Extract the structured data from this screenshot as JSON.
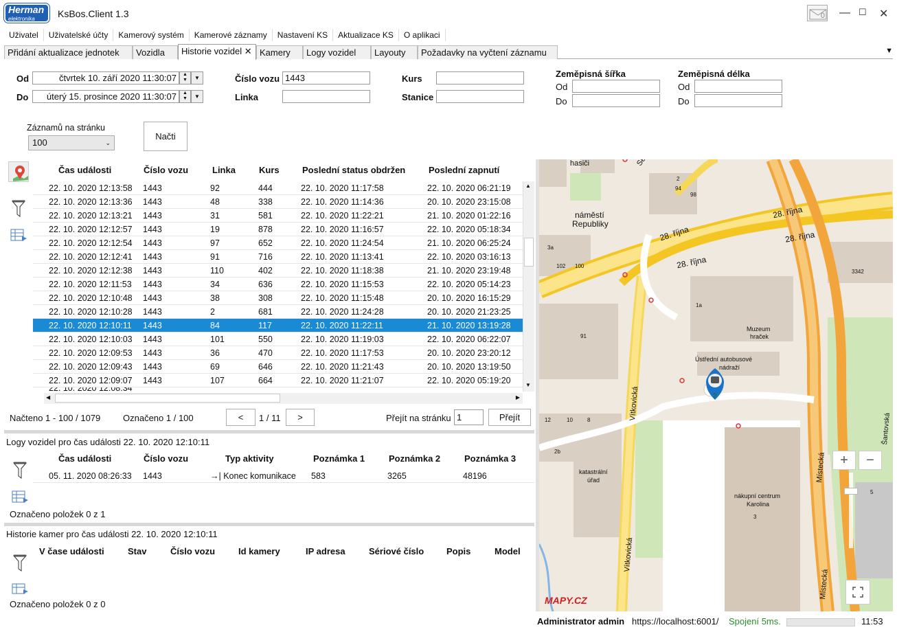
{
  "app": {
    "logo_line1": "Herman",
    "logo_line2": "elektronika",
    "title": "KsBos.Client 1.3",
    "mail_count": "0"
  },
  "menu": [
    "Uživatel",
    "Uživatelské účty",
    "Kamerový systém",
    "Kamerové záznamy",
    "Nastavení KS",
    "Aktualizace KS",
    "O aplikaci"
  ],
  "tabs": [
    {
      "label": "Přidání aktualizace jednotek"
    },
    {
      "label": "Vozidla"
    },
    {
      "label": "Historie vozidel"
    },
    {
      "label": "Kamery"
    },
    {
      "label": "Logy vozidel"
    },
    {
      "label": "Layouty"
    },
    {
      "label": "Požadavky na vyčtení záznamu"
    }
  ],
  "filters": {
    "od_label": "Od",
    "do_label": "Do",
    "od_value": "čtvrtek 10. září 2020 11:30:07",
    "do_value": "úterý 15. prosince 2020 11:30:07",
    "cislo_vozu_label": "Číslo vozu",
    "cislo_vozu_value": "1443",
    "linka_label": "Linka",
    "linka_value": "",
    "kurs_label": "Kurs",
    "kurs_value": "",
    "stanice_label": "Stanice",
    "stanice_value": "",
    "lat_label": "Zeměpisná šířka",
    "lon_label": "Zeměpisná délka",
    "lat_od_label": "Od",
    "lat_do_label": "Do",
    "lon_od_label": "Od",
    "lon_do_label": "Do",
    "per_page_label": "Záznamů na stránku",
    "per_page_value": "100",
    "load_button": "Načti"
  },
  "grid": {
    "headers": [
      "Čas události",
      "Číslo vozu",
      "Linka",
      "Kurs",
      "Poslední status obdržen",
      "Poslední zapnutí"
    ],
    "rows": [
      [
        "22. 10. 2020 12:13:58",
        "1443",
        "92",
        "444",
        "22. 10. 2020 11:17:58",
        "22. 10. 2020 06:21:19"
      ],
      [
        "22. 10. 2020 12:13:36",
        "1443",
        "48",
        "338",
        "22. 10. 2020 11:14:36",
        "20. 10. 2020 23:15:08"
      ],
      [
        "22. 10. 2020 12:13:21",
        "1443",
        "31",
        "581",
        "22. 10. 2020 11:22:21",
        "21. 10. 2020 01:22:16"
      ],
      [
        "22. 10. 2020 12:12:57",
        "1443",
        "19",
        "878",
        "22. 10. 2020 11:16:57",
        "22. 10. 2020 05:18:34"
      ],
      [
        "22. 10. 2020 12:12:54",
        "1443",
        "97",
        "652",
        "22. 10. 2020 11:24:54",
        "21. 10. 2020 06:25:24"
      ],
      [
        "22. 10. 2020 12:12:41",
        "1443",
        "91",
        "716",
        "22. 10. 2020 11:13:41",
        "22. 10. 2020 03:16:13"
      ],
      [
        "22. 10. 2020 12:12:38",
        "1443",
        "110",
        "402",
        "22. 10. 2020 11:18:38",
        "21. 10. 2020 23:19:48"
      ],
      [
        "22. 10. 2020 12:11:53",
        "1443",
        "34",
        "636",
        "22. 10. 2020 11:15:53",
        "22. 10. 2020 05:14:23"
      ],
      [
        "22. 10. 2020 12:10:48",
        "1443",
        "38",
        "308",
        "22. 10. 2020 11:15:48",
        "20. 10. 2020 16:15:29"
      ],
      [
        "22. 10. 2020 12:10:28",
        "1443",
        "2",
        "681",
        "22. 10. 2020 11:24:28",
        "20. 10. 2020 21:23:25"
      ],
      [
        "22. 10. 2020 12:10:11",
        "1443",
        "84",
        "117",
        "22. 10. 2020 11:22:11",
        "21. 10. 2020 13:19:28"
      ],
      [
        "22. 10. 2020 12:10:03",
        "1443",
        "101",
        "550",
        "22. 10. 2020 11:19:03",
        "22. 10. 2020 06:22:07"
      ],
      [
        "22. 10. 2020 12:09:53",
        "1443",
        "36",
        "470",
        "22. 10. 2020 11:17:53",
        "20. 10. 2020 23:20:12"
      ],
      [
        "22. 10. 2020 12:09:43",
        "1443",
        "69",
        "646",
        "22. 10. 2020 11:21:43",
        "20. 10. 2020 13:19:50"
      ],
      [
        "22. 10. 2020 12:09:07",
        "1443",
        "107",
        "664",
        "22. 10. 2020 11:21:07",
        "22. 10. 2020 05:19:20"
      ]
    ],
    "selected_row": 10,
    "loaded": "Načteno 1 - 100 / 1079",
    "marked": "Označeno 1 / 100",
    "prev": "<",
    "page": "1 / 11",
    "next": ">",
    "goto_label": "Přejít na stránku",
    "goto_value": "1",
    "goto_button": "Přejít"
  },
  "logs": {
    "title": "Logy vozidel pro čas události 22. 10. 2020 12:10:11",
    "headers": [
      "Čas události",
      "Číslo vozu",
      "Typ aktivity",
      "Poznámka 1",
      "Poznámka 2",
      "Poznámka 3"
    ],
    "row": [
      "05. 11. 2020 08:26:33",
      "1443",
      "→| Konec komunikace",
      "583",
      "3265",
      "48196"
    ],
    "marked": "Označeno položek 0 z 1"
  },
  "cameras": {
    "title": "Historie kamer pro čas události 22. 10. 2020 12:10:11",
    "headers": [
      "V čase události",
      "Stav",
      "Číslo vozu",
      "Id kamery",
      "IP adresa",
      "Sériové číslo",
      "Popis",
      "Model"
    ],
    "marked": "Označeno položek 0 z 0"
  },
  "map": {
    "labels": {
      "hasici": "hasiči",
      "senovazne": "Senovážné",
      "namesti": "náměstí",
      "republiky": "Republiky",
      "rijna1": "28. října",
      "rijna2": "28. října",
      "rijna3": "28. října",
      "rijna4": "28. října",
      "muzeum": "Muzeum",
      "hracek": "hraček",
      "ustredni": "Ústřední autobusové",
      "nadrazi": "nádraží",
      "vitkovicka": "Vítkovická",
      "vitkovicka2": "Vítkovická",
      "katastralni": "katastrální",
      "urad": "úřad",
      "karolina": "nákupní centrum",
      "karolina2": "Karolina",
      "mistecka": "Místecká",
      "mistecka2": "Místecká",
      "santovska": "Šantovská",
      "n94": "94",
      "n98": "98",
      "n2": "2",
      "n3a": "3a",
      "n102": "102",
      "n100": "100",
      "n3342": "3342",
      "n1a": "1a",
      "n91": "91",
      "n12": "12",
      "n10": "10",
      "n8": "8",
      "n2b": "2b",
      "n3": "3",
      "n5": "5",
      "brand": "MAPY.CZ",
      "zoom_in": "+",
      "zoom_out": "−"
    }
  },
  "status": {
    "user": "Administrator admin",
    "url": "https://localhost:6001/",
    "connection": "Spojení 5ms.",
    "time": "11:53"
  },
  "colors": {
    "selected": "#1a8ad4",
    "road": "#f5d75a",
    "road_main": "#f3c623",
    "arterial": "#f2a53a",
    "water": "#fff",
    "building": "#d9cfc3",
    "green": "#cfe6b8",
    "pin": "#1a73c9",
    "connection": "#2e8b2e"
  }
}
